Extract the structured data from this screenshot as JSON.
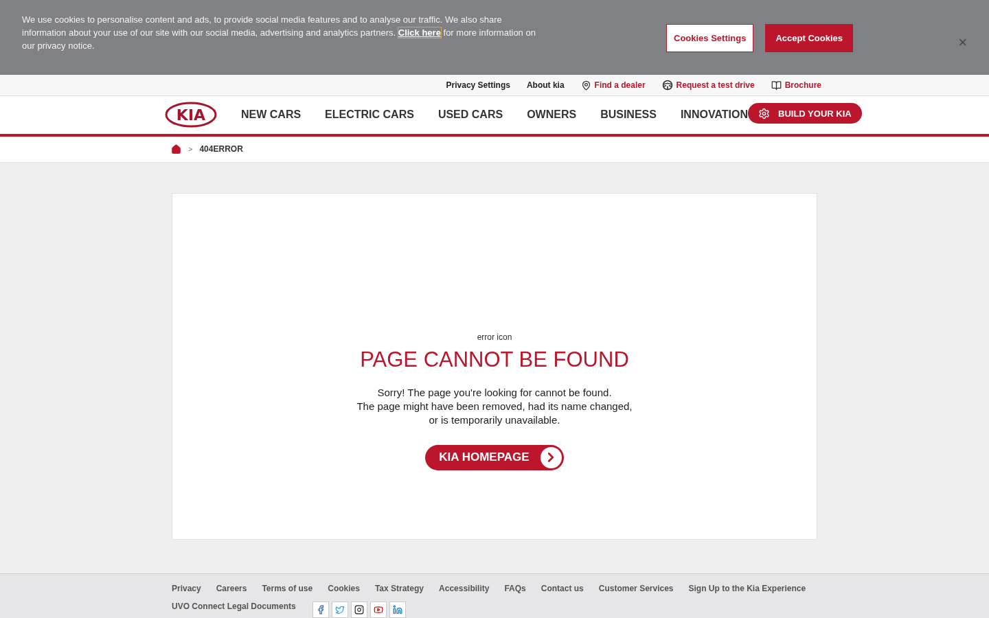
{
  "cookie_banner": {
    "text_before": "We use cookies to personalise content and ads, to provide social media features and to analyse our traffic. We also share information about your use of our site with our social media, advertising and analytics partners.",
    "link": "Click here",
    "text_after": "for more information on our privacy notice.",
    "settings_button": "Cookies Settings",
    "accept_button": "Accept Cookies",
    "close": "×"
  },
  "utility_links": [
    {
      "label": "Privacy Settings",
      "kind": "plain"
    },
    {
      "label": "About kia",
      "kind": "plain"
    },
    {
      "label": "Find a dealer",
      "kind": "pin"
    },
    {
      "label": "Request a test drive",
      "kind": "wheel"
    },
    {
      "label": "Brochure",
      "kind": "book"
    }
  ],
  "logo": "KIA",
  "nav": [
    "NEW CARS",
    "ELECTRIC CARS",
    "USED CARS",
    "OWNERS",
    "BUSINESS",
    "INNOVATION"
  ],
  "build_button": "BUILD YOUR KIA",
  "breadcrumb": {
    "separator": ">",
    "current": "404ERROR"
  },
  "error": {
    "icon_alt": "error icon",
    "title": "PAGE CANNOT BE FOUND",
    "lines": [
      "Sorry! The page you're looking for cannot be found.",
      "The page might have been removed, had its name changed,",
      "or is temporarily unavailable."
    ],
    "button": "KIA HOMEPAGE"
  },
  "footer": {
    "links": [
      "Privacy",
      "Careers",
      "Terms of use",
      "Cookies",
      "Tax Strategy",
      "Accessibility",
      "FAQs",
      "Contact us",
      "Customer Services",
      "Sign Up to the Kia Experience"
    ],
    "second_link": "UVO Connect Legal Documents",
    "social": [
      {
        "kind": "facebook"
      },
      {
        "kind": "twitter"
      },
      {
        "kind": "instagram"
      },
      {
        "kind": "youtube"
      },
      {
        "kind": "linkedin"
      }
    ]
  }
}
